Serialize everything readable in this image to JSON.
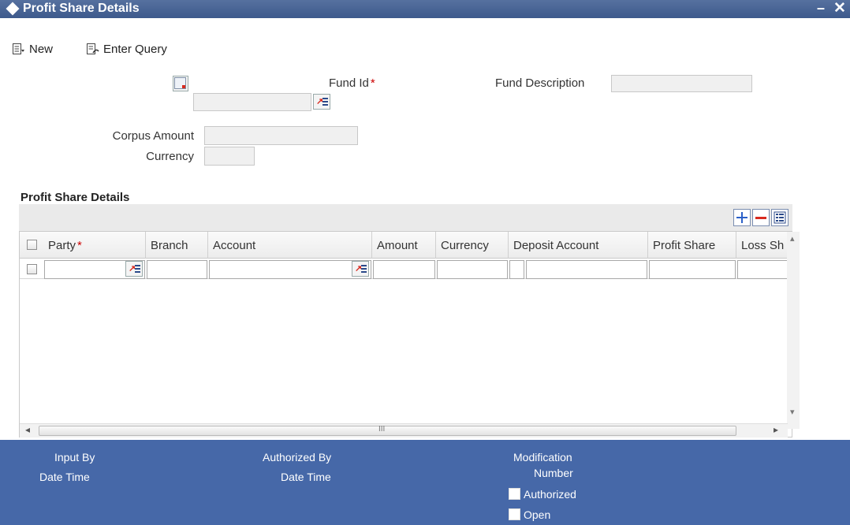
{
  "window": {
    "title": "Profit Share Details",
    "minimize_glyph": "–",
    "close_glyph": "✕"
  },
  "toolbar": {
    "new_label": "New",
    "enter_query_label": "Enter Query"
  },
  "form": {
    "fund_id_label": "Fund Id",
    "fund_description_label": "Fund Description",
    "corpus_amount_label": "Corpus Amount",
    "currency_label": "Currency",
    "required_marker": "*"
  },
  "grid": {
    "section_title": "Profit Share Details",
    "columns": [
      "Party",
      "Branch",
      "Account",
      "Amount",
      "Currency",
      "Deposit Account",
      "Profit Share",
      "Loss Sh"
    ],
    "required_marker": "*",
    "hscroll_grip": "III",
    "arrow_left": "◂",
    "arrow_right": "▸",
    "arrow_up": "▴",
    "arrow_down": "▾"
  },
  "footer": {
    "input_by_label": "Input By",
    "date_time_label_1": "Date Time",
    "authorized_by_label": "Authorized By",
    "date_time_label_2": "Date Time",
    "modification_label": "Modification",
    "number_label": "Number",
    "authorized_check_label": "Authorized",
    "open_check_label": "Open"
  },
  "colors": {
    "titlebar": "#3d5a8c",
    "footer": "#4668a8",
    "required": "#cc0000",
    "lov_arrow": "#d82a1f"
  },
  "icons": {
    "title": "diamond-icon",
    "new": "new-document-icon",
    "enter_query": "enter-query-icon",
    "lov": "list-of-values-icon",
    "add_row": "plus-icon",
    "delete_row": "minus-icon",
    "single_view": "single-record-view-icon"
  }
}
